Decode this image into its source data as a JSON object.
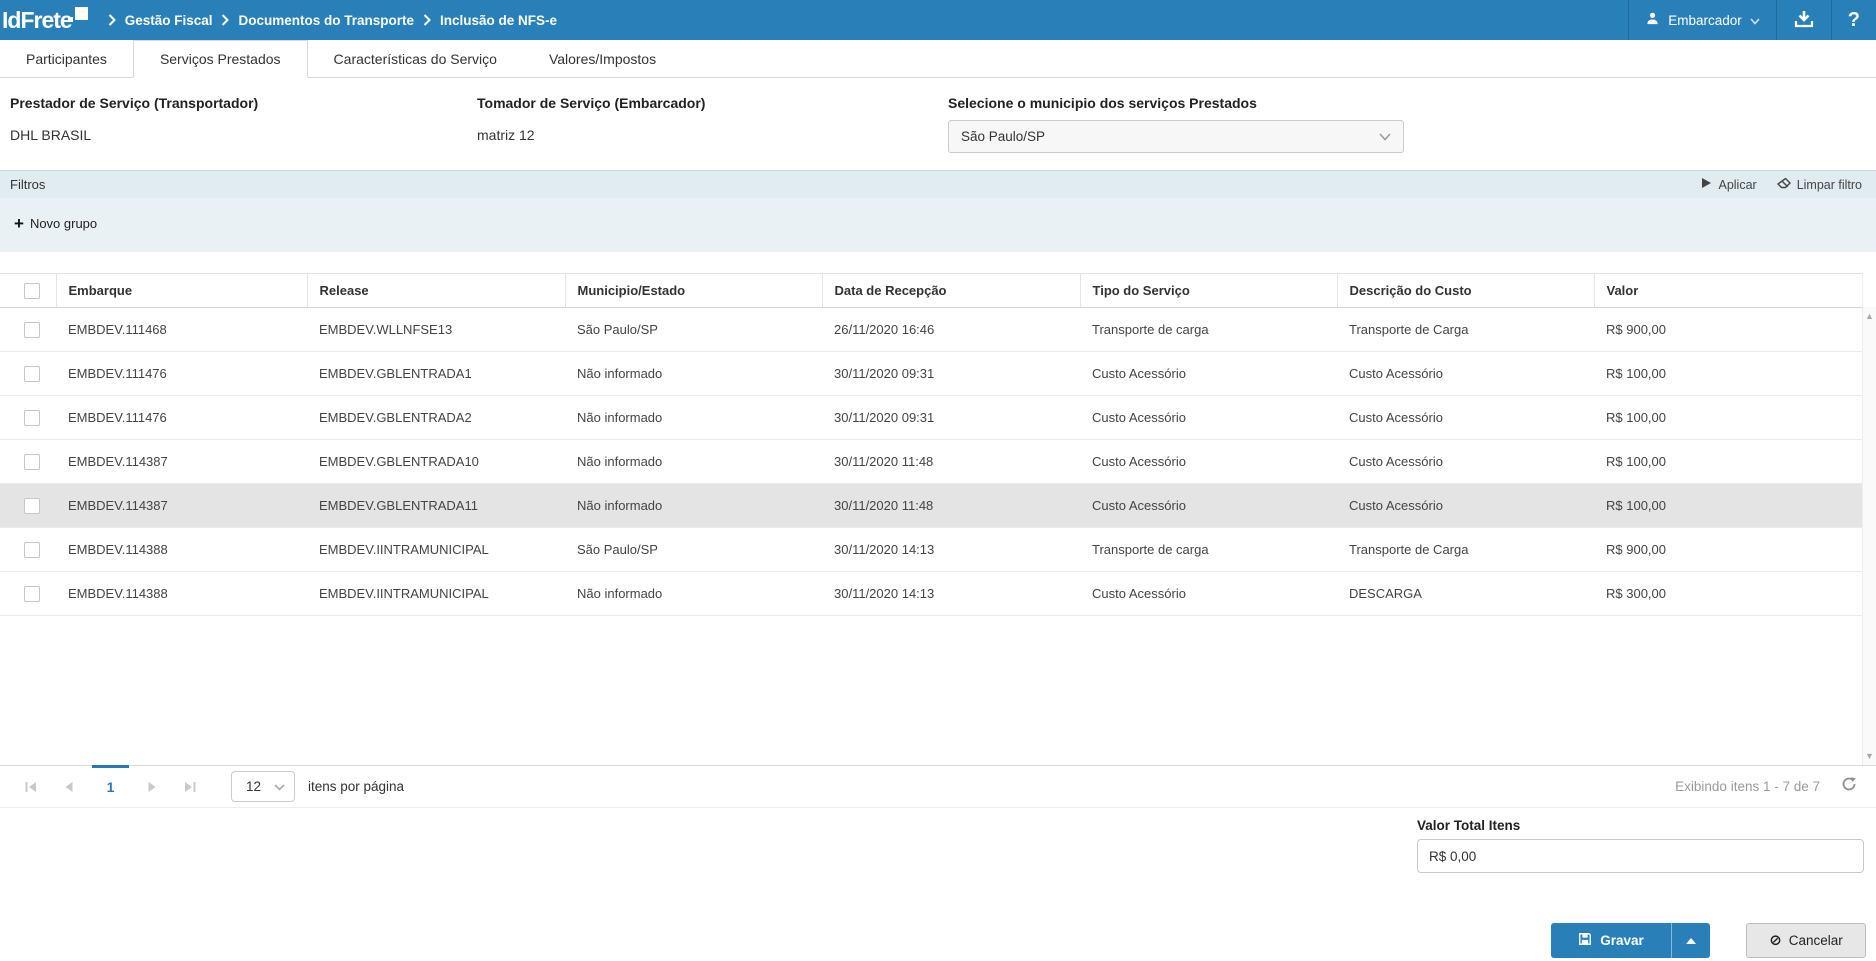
{
  "colors": {
    "accent": "#2980b9",
    "filters_bg": "#e1ecf0",
    "row_highlight": "#e4e4e4"
  },
  "topbar": {
    "logo": "IdFrete",
    "breadcrumb": [
      "Gestão Fiscal",
      "Documentos do Transporte",
      "Inclusão de NFS-e"
    ],
    "user_label": "Embarcador",
    "help_glyph": "?"
  },
  "tabs": [
    {
      "label": "Participantes",
      "active": false
    },
    {
      "label": "Serviços Prestados",
      "active": true
    },
    {
      "label": "Características do Serviço",
      "active": false
    },
    {
      "label": "Valores/Impostos",
      "active": false
    }
  ],
  "form": {
    "prestador_label": "Prestador de Serviço (Transportador)",
    "prestador_value": "DHL BRASIL",
    "tomador_label": "Tomador de Serviço (Embarcador)",
    "tomador_value": "matriz 12",
    "municipio_label": "Selecione o municipio dos serviços Prestados",
    "municipio_value": "São Paulo/SP"
  },
  "filters": {
    "title": "Filtros",
    "apply_label": "Aplicar",
    "clear_label": "Limpar filtro",
    "new_group_label": "Novo grupo"
  },
  "table": {
    "columns": [
      "Embarque",
      "Release",
      "Municipio/Estado",
      "Data de Recepção",
      "Tipo do Serviço",
      "Descrição do Custo",
      "Valor"
    ],
    "rows": [
      {
        "embarque": "EMBDEV.111468",
        "release": "EMBDEV.WLLNFSE13",
        "municipio": "São Paulo/SP",
        "data_recepcao": "26/11/2020 16:46",
        "tipo": "Transporte de carga",
        "descricao": "Transporte de Carga",
        "valor": "R$ 900,00",
        "highlighted": false
      },
      {
        "embarque": "EMBDEV.111476",
        "release": "EMBDEV.GBLENTRADA1",
        "municipio": "Não informado",
        "data_recepcao": "30/11/2020 09:31",
        "tipo": "Custo Acessório",
        "descricao": "Custo Acessório",
        "valor": "R$ 100,00",
        "highlighted": false
      },
      {
        "embarque": "EMBDEV.111476",
        "release": "EMBDEV.GBLENTRADA2",
        "municipio": "Não informado",
        "data_recepcao": "30/11/2020 09:31",
        "tipo": "Custo Acessório",
        "descricao": "Custo Acessório",
        "valor": "R$ 100,00",
        "highlighted": false
      },
      {
        "embarque": "EMBDEV.114387",
        "release": "EMBDEV.GBLENTRADA10",
        "municipio": "Não informado",
        "data_recepcao": "30/11/2020 11:48",
        "tipo": "Custo Acessório",
        "descricao": "Custo Acessório",
        "valor": "R$ 100,00",
        "highlighted": false
      },
      {
        "embarque": "EMBDEV.114387",
        "release": "EMBDEV.GBLENTRADA11",
        "municipio": "Não informado",
        "data_recepcao": "30/11/2020 11:48",
        "tipo": "Custo Acessório",
        "descricao": "Custo Acessório",
        "valor": "R$ 100,00",
        "highlighted": true
      },
      {
        "embarque": "EMBDEV.114388",
        "release": "EMBDEV.IINTRAMUNICIPAL",
        "municipio": "São Paulo/SP",
        "data_recepcao": "30/11/2020 14:13",
        "tipo": "Transporte de carga",
        "descricao": "Transporte de Carga",
        "valor": "R$ 900,00",
        "highlighted": false
      },
      {
        "embarque": "EMBDEV.114388",
        "release": "EMBDEV.IINTRAMUNICIPAL",
        "municipio": "Não informado",
        "data_recepcao": "30/11/2020 14:13",
        "tipo": "Custo Acessório",
        "descricao": "DESCARGA",
        "valor": "R$ 300,00",
        "highlighted": false
      }
    ]
  },
  "pagination": {
    "current_page": "1",
    "page_size": "12",
    "per_page_label": "itens por página",
    "status": "Exibindo itens 1 - 7 de 7"
  },
  "totals": {
    "label": "Valor Total Itens",
    "value": "R$ 0,00"
  },
  "actions": {
    "save_label": "Gravar",
    "cancel_label": "Cancelar"
  }
}
